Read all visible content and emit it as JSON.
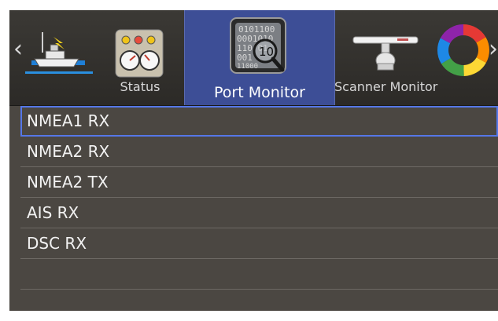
{
  "tabs": [
    {
      "id": "boat",
      "label": "",
      "icon": "boat-radio-icon"
    },
    {
      "id": "status",
      "label": "Status",
      "icon": "gauge-panel-icon"
    },
    {
      "id": "port",
      "label": "Port Monitor",
      "icon": "binary-magnifier-icon",
      "selected": true
    },
    {
      "id": "scanner",
      "label": "Scanner Monitor",
      "icon": "radar-scanner-icon"
    },
    {
      "id": "color",
      "label": "",
      "icon": "color-wheel-icon"
    }
  ],
  "nav": {
    "left": "‹",
    "right": "›"
  },
  "ports": [
    "NMEA1 RX",
    "NMEA2 RX",
    "NMEA2 TX",
    "AIS RX",
    "DSC RX",
    "",
    ""
  ],
  "binary_text": [
    "0101100",
    "0001010",
    "110 01",
    "001",
    "11000"
  ],
  "tile_number": "10",
  "colors": {
    "accent": "#3d4e96",
    "selection": "#5577e8",
    "background": "#4b4742"
  }
}
